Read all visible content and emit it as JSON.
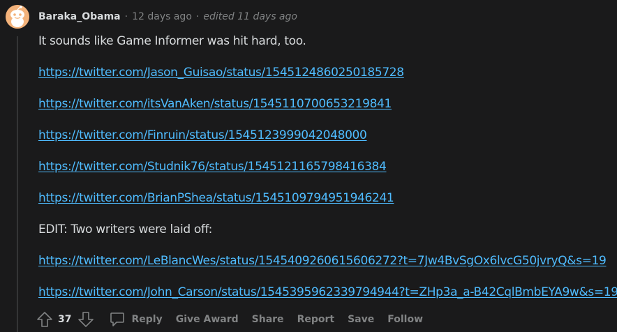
{
  "comment": {
    "author": "Baraka_Obama",
    "separator": "·",
    "time": "12 days ago",
    "edited": "edited 11 days ago",
    "paragraphs": [
      {
        "text": "It sounds like Game Informer was hit hard, too."
      },
      {
        "link": "https://twitter.com/Jason_Guisao/status/1545124860250185728"
      },
      {
        "link": "https://twitter.com/itsVanAken/status/1545110700653219841"
      },
      {
        "link": "https://twitter.com/Finruin/status/1545123999042048000"
      },
      {
        "link": "https://twitter.com/Studnik76/status/1545121165798416384"
      },
      {
        "link": "https://twitter.com/BrianPShea/status/1545109794951946241"
      },
      {
        "text": "EDIT: Two writers were laid off:"
      },
      {
        "link": "https://twitter.com/LeBlancWes/status/1545409260615606272?t=7Jw4BvSgOx6lvcG50jvryQ&s=19"
      },
      {
        "link": "https://twitter.com/John_Carson/status/1545395962339794944?t=ZHp3a_a-B42CqlBmbEYA9w&s=19"
      }
    ],
    "score": "37",
    "actions": {
      "reply": "Reply",
      "give_award": "Give Award",
      "share": "Share",
      "report": "Report",
      "save": "Save",
      "follow": "Follow"
    }
  },
  "icons": {
    "avatar": "snoo-avatar-icon",
    "upvote": "upvote-arrow-icon",
    "downvote": "downvote-arrow-icon",
    "reply": "comment-bubble-icon"
  },
  "colors": {
    "background": "#1a1a1b",
    "text": "#d7dadc",
    "muted": "#818384",
    "link": "#4fbcff",
    "avatar": "#f3b27a",
    "thread_line": "#343536"
  }
}
